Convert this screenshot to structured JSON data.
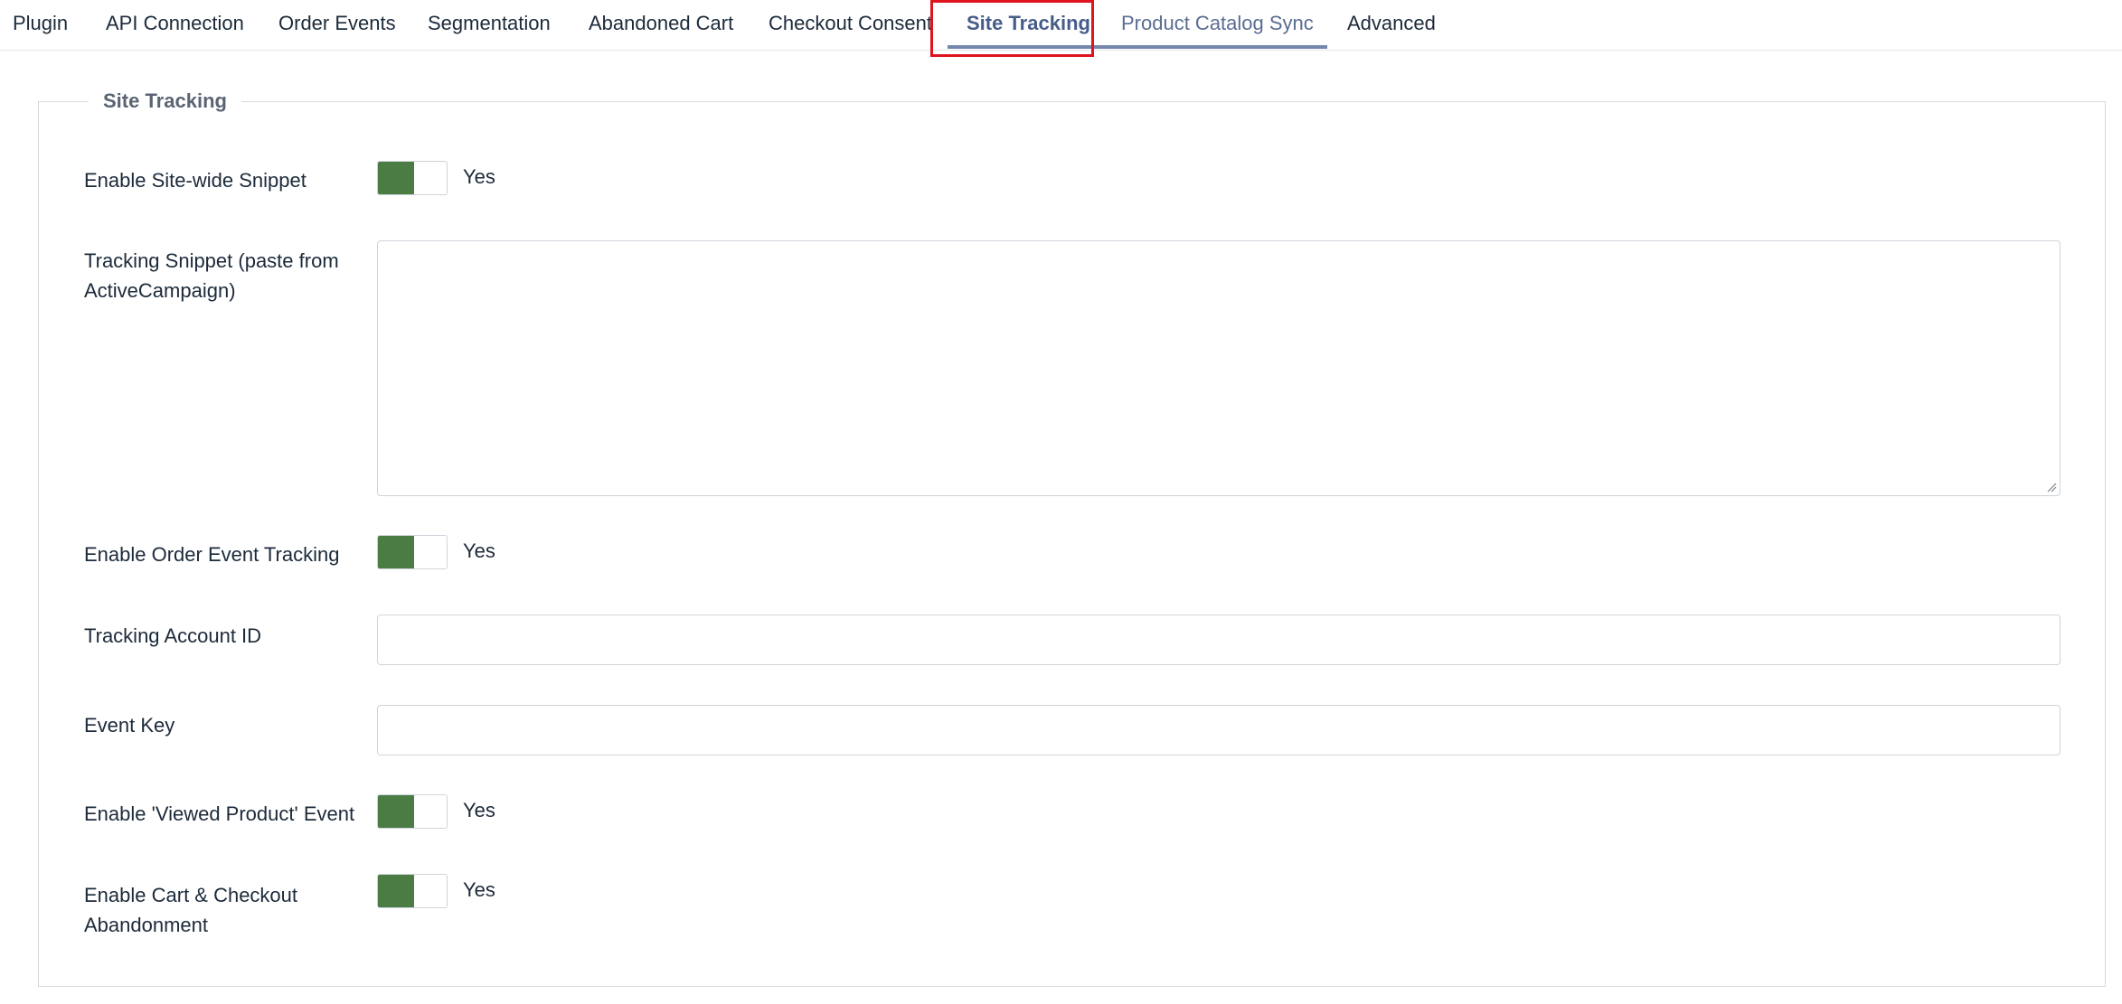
{
  "tabs": [
    {
      "label": "Plugin"
    },
    {
      "label": "API Connection"
    },
    {
      "label": "Order Events"
    },
    {
      "label": "Segmentation"
    },
    {
      "label": "Abandoned Cart"
    },
    {
      "label": "Checkout Consent"
    },
    {
      "label": "Site Tracking",
      "active": true
    },
    {
      "label": "Product Catalog Sync"
    },
    {
      "label": "Advanced"
    }
  ],
  "fieldset": {
    "legend": "Site Tracking"
  },
  "fields": {
    "sitewide_snippet": {
      "label": "Enable Site-wide Snippet",
      "value": "Yes",
      "enabled": true
    },
    "tracking_snippet": {
      "label": "Tracking Snippet (paste from ActiveCampaign)",
      "value": "",
      "placeholder": ""
    },
    "order_event_tracking": {
      "label": "Enable Order Event Tracking",
      "value": "Yes",
      "enabled": true
    },
    "tracking_account_id": {
      "label": "Tracking Account ID",
      "value": "",
      "placeholder": ""
    },
    "event_key": {
      "label": "Event Key",
      "value": "",
      "placeholder": ""
    },
    "viewed_product_event": {
      "label": "Enable 'Viewed Product' Event",
      "value": "Yes",
      "enabled": true
    },
    "cart_checkout_abandonment": {
      "label": "Enable Cart & Checkout Abandonment",
      "value": "Yes",
      "enabled": true
    }
  },
  "colors": {
    "toggle_on": "#4a7c44",
    "active_tab": "#465c8a",
    "tab_underline": "#7487ab",
    "highlight": "#e0141e"
  },
  "icons": {
    "resize_grip": "resize-grip-icon"
  }
}
